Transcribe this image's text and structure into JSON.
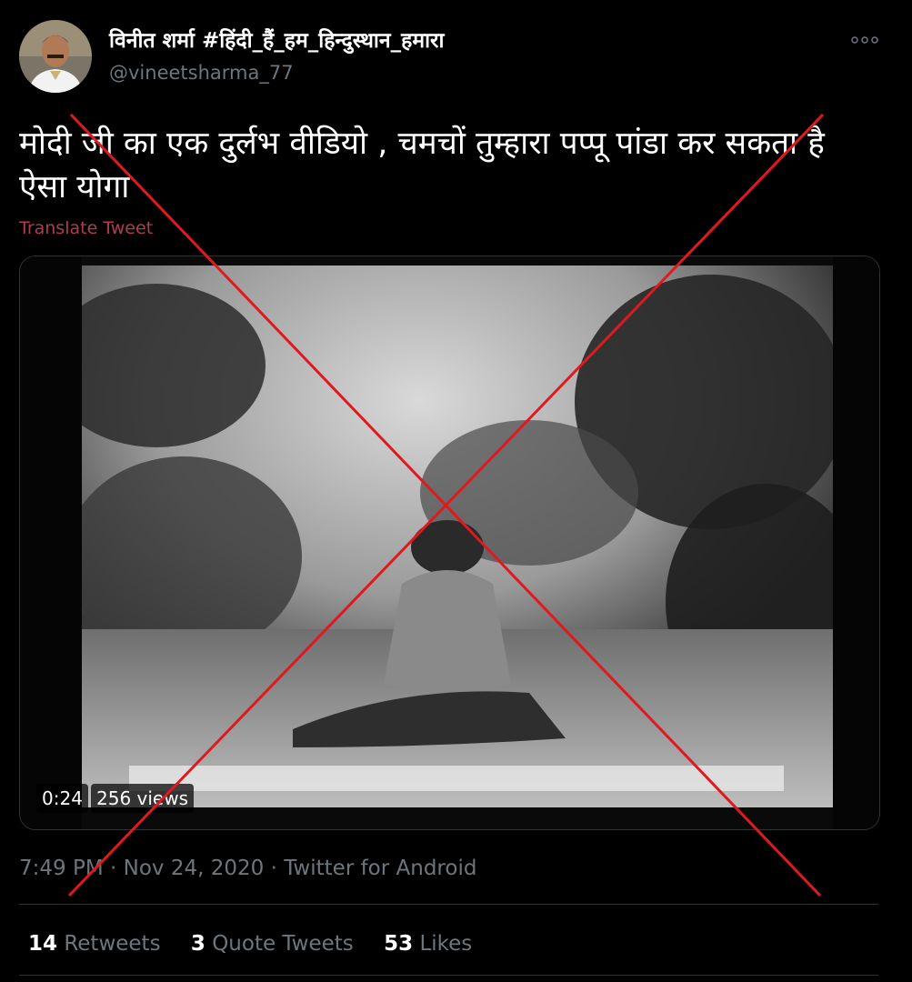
{
  "author": {
    "display_name": "विनीत शर्मा #हिंदी_हैं_हम_हिन्दुस्थान_हमारा",
    "handle": "@vineetsharma_77",
    "avatar_icon": "profile-photo"
  },
  "tweet": {
    "text": "मोदी जी का एक दुर्लभ वीडियो ,  चमचों तुम्हारा पप्पू पांडा कर सकता है ऐसा योगा",
    "translate_label": "Translate Tweet"
  },
  "video": {
    "duration": "0:24",
    "views": "256 views"
  },
  "meta": {
    "time": "7:49 PM",
    "separator": "·",
    "date": "Nov 24, 2020",
    "source": "Twitter for Android"
  },
  "stats": {
    "retweets_count": "14",
    "retweets_label": "Retweets",
    "quotes_count": "3",
    "quotes_label": "Quote Tweets",
    "likes_count": "53",
    "likes_label": "Likes"
  },
  "colors": {
    "background": "#000000",
    "translate_link": "#b23b52",
    "cross_mark": "#e0191f",
    "secondary_text": "#6e767d"
  }
}
